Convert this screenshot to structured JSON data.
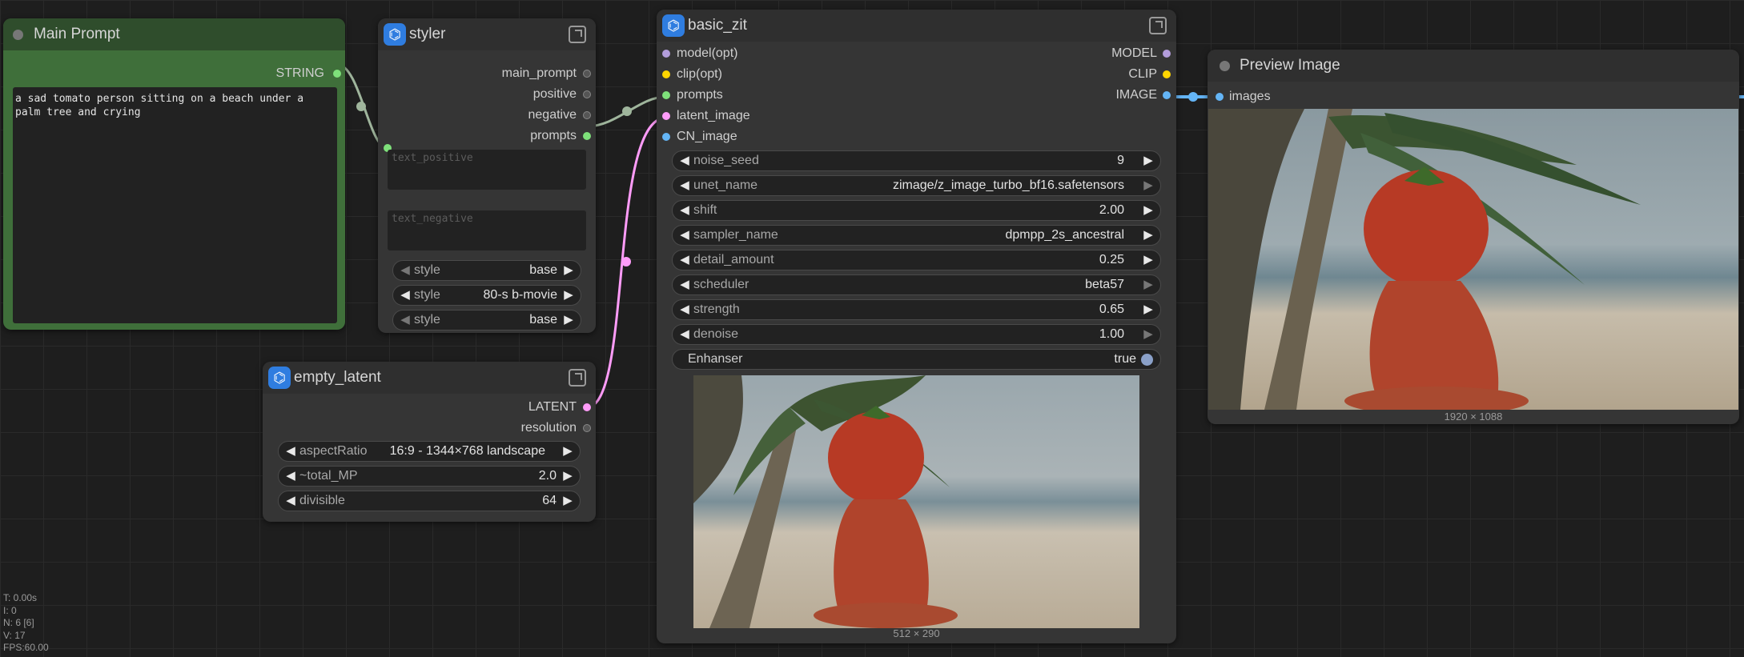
{
  "nodes": {
    "main_prompt": {
      "title": "Main Prompt",
      "output_label": "STRING",
      "text": "a sad tomato person sitting on a beach under a palm tree and crying"
    },
    "styler": {
      "title": "styler",
      "inputs": [
        "main_prompt",
        "positive",
        "negative",
        "prompts"
      ],
      "text_positive_placeholder": "text_positive",
      "text_negative_placeholder": "text_negative",
      "widgets": [
        {
          "label": "style",
          "value": "base"
        },
        {
          "label": "style",
          "value": "80-s b-movie"
        },
        {
          "label": "style",
          "value": "base"
        }
      ]
    },
    "empty_latent": {
      "title": "empty_latent",
      "outputs": [
        "LATENT",
        "resolution"
      ],
      "widgets": [
        {
          "label": "aspectRatio",
          "value": "16:9 - 1344×768 landscape"
        },
        {
          "label": "~total_MP",
          "value": "2.0"
        },
        {
          "label": "divisible",
          "value": "64"
        }
      ]
    },
    "basic_zit": {
      "title": "basic_zit",
      "inputs": [
        "model(opt)",
        "clip(opt)",
        "prompts",
        "latent_image",
        "CN_image"
      ],
      "outputs": [
        "MODEL",
        "CLIP",
        "IMAGE"
      ],
      "widgets": [
        {
          "label": "noise_seed",
          "value": "9"
        },
        {
          "label": "unet_name",
          "value": "zimage/z_image_turbo_bf16.safetensors"
        },
        {
          "label": "shift",
          "value": "2.00"
        },
        {
          "label": "sampler_name",
          "value": "dpmpp_2s_ancestral"
        },
        {
          "label": "detail_amount",
          "value": "0.25"
        },
        {
          "label": "scheduler",
          "value": "beta57"
        },
        {
          "label": "strength",
          "value": "0.65"
        },
        {
          "label": "denoise",
          "value": "1.00"
        }
      ],
      "toggle": {
        "label": "Enhanser",
        "value": "true"
      },
      "image_caption": "512 × 290"
    },
    "preview_image": {
      "title": "Preview Image",
      "input_label": "images",
      "image_caption": "1920 × 1088"
    }
  },
  "stats": {
    "t": "T: 0.00s",
    "i": "I: 0",
    "n": "N: 6 [6]",
    "v": "V: 17",
    "fps": "FPS:60.00"
  },
  "colors": {
    "background": "#1e1e1e",
    "node_body": "#353535",
    "main_prompt_green": "#3f6f3a",
    "string_link": "#9fb59c",
    "latent_link": "#ff9cf9",
    "image_link": "#64b5f6",
    "model_slot": "#b39ddb",
    "clip_slot": "#ffd500"
  },
  "icons": [
    "node-graph-icon",
    "pin-icon",
    "collapse-dot-icon",
    "arrow-left-icon",
    "arrow-right-icon",
    "toggle-knob-icon"
  ]
}
